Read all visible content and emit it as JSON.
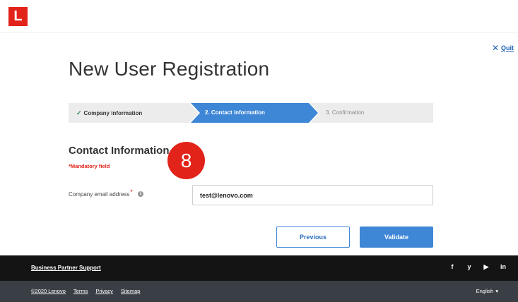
{
  "brand": {
    "logo_letter": "L",
    "accent": "#e2231a",
    "primary": "#3e86d6"
  },
  "header": {
    "quit_icon": "✕",
    "quit_label": "Quit"
  },
  "page": {
    "title": "New User Registration"
  },
  "stepper": {
    "steps": [
      {
        "label": "Company information",
        "state": "completed"
      },
      {
        "label": "2. Contact information",
        "state": "active"
      },
      {
        "label": "3. Confirmation",
        "state": "upcoming"
      }
    ]
  },
  "section": {
    "title": "Contact Information",
    "mandatory_note": "*Mandatory field",
    "badge_number": "8"
  },
  "form": {
    "email_label": "Company email address",
    "email_required_mark": "*",
    "email_value": "test@lenovo.com"
  },
  "actions": {
    "previous_label": "Previous",
    "validate_label": "Validate"
  },
  "footer": {
    "support_link": "Business Partner Support",
    "social": [
      {
        "icon": "facebook-icon",
        "glyph": "f"
      },
      {
        "icon": "twitter-icon",
        "glyph": "y"
      },
      {
        "icon": "youtube-icon",
        "glyph": "▶"
      },
      {
        "icon": "linkedin-icon",
        "glyph": "in"
      }
    ],
    "links": [
      "©2020 Lenovo",
      "Terms",
      "Privacy",
      "Sitemap"
    ],
    "language": "English",
    "language_caret": "▾"
  }
}
